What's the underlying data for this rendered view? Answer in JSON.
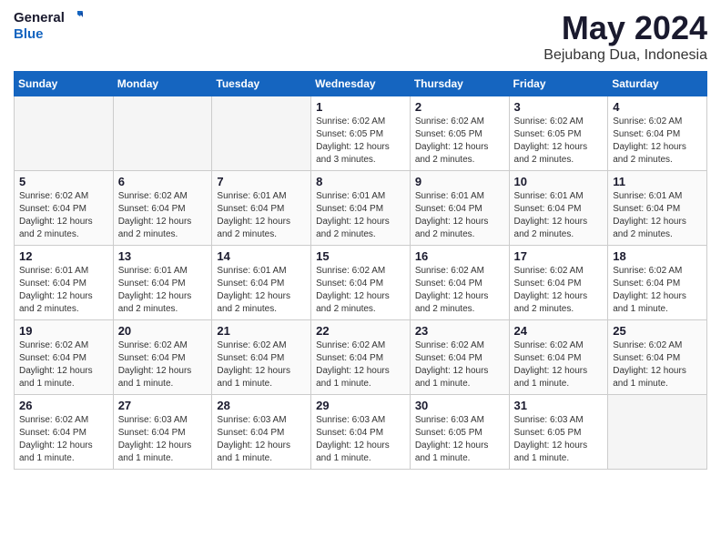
{
  "header": {
    "logo_line1": "General",
    "logo_line2": "Blue",
    "month_year": "May 2024",
    "location": "Bejubang Dua, Indonesia"
  },
  "days_of_week": [
    "Sunday",
    "Monday",
    "Tuesday",
    "Wednesday",
    "Thursday",
    "Friday",
    "Saturday"
  ],
  "weeks": [
    [
      {
        "day": "",
        "info": ""
      },
      {
        "day": "",
        "info": ""
      },
      {
        "day": "",
        "info": ""
      },
      {
        "day": "1",
        "info": "Sunrise: 6:02 AM\nSunset: 6:05 PM\nDaylight: 12 hours\nand 3 minutes."
      },
      {
        "day": "2",
        "info": "Sunrise: 6:02 AM\nSunset: 6:05 PM\nDaylight: 12 hours\nand 2 minutes."
      },
      {
        "day": "3",
        "info": "Sunrise: 6:02 AM\nSunset: 6:05 PM\nDaylight: 12 hours\nand 2 minutes."
      },
      {
        "day": "4",
        "info": "Sunrise: 6:02 AM\nSunset: 6:04 PM\nDaylight: 12 hours\nand 2 minutes."
      }
    ],
    [
      {
        "day": "5",
        "info": "Sunrise: 6:02 AM\nSunset: 6:04 PM\nDaylight: 12 hours\nand 2 minutes."
      },
      {
        "day": "6",
        "info": "Sunrise: 6:02 AM\nSunset: 6:04 PM\nDaylight: 12 hours\nand 2 minutes."
      },
      {
        "day": "7",
        "info": "Sunrise: 6:01 AM\nSunset: 6:04 PM\nDaylight: 12 hours\nand 2 minutes."
      },
      {
        "day": "8",
        "info": "Sunrise: 6:01 AM\nSunset: 6:04 PM\nDaylight: 12 hours\nand 2 minutes."
      },
      {
        "day": "9",
        "info": "Sunrise: 6:01 AM\nSunset: 6:04 PM\nDaylight: 12 hours\nand 2 minutes."
      },
      {
        "day": "10",
        "info": "Sunrise: 6:01 AM\nSunset: 6:04 PM\nDaylight: 12 hours\nand 2 minutes."
      },
      {
        "day": "11",
        "info": "Sunrise: 6:01 AM\nSunset: 6:04 PM\nDaylight: 12 hours\nand 2 minutes."
      }
    ],
    [
      {
        "day": "12",
        "info": "Sunrise: 6:01 AM\nSunset: 6:04 PM\nDaylight: 12 hours\nand 2 minutes."
      },
      {
        "day": "13",
        "info": "Sunrise: 6:01 AM\nSunset: 6:04 PM\nDaylight: 12 hours\nand 2 minutes."
      },
      {
        "day": "14",
        "info": "Sunrise: 6:01 AM\nSunset: 6:04 PM\nDaylight: 12 hours\nand 2 minutes."
      },
      {
        "day": "15",
        "info": "Sunrise: 6:02 AM\nSunset: 6:04 PM\nDaylight: 12 hours\nand 2 minutes."
      },
      {
        "day": "16",
        "info": "Sunrise: 6:02 AM\nSunset: 6:04 PM\nDaylight: 12 hours\nand 2 minutes."
      },
      {
        "day": "17",
        "info": "Sunrise: 6:02 AM\nSunset: 6:04 PM\nDaylight: 12 hours\nand 2 minutes."
      },
      {
        "day": "18",
        "info": "Sunrise: 6:02 AM\nSunset: 6:04 PM\nDaylight: 12 hours\nand 1 minute."
      }
    ],
    [
      {
        "day": "19",
        "info": "Sunrise: 6:02 AM\nSunset: 6:04 PM\nDaylight: 12 hours\nand 1 minute."
      },
      {
        "day": "20",
        "info": "Sunrise: 6:02 AM\nSunset: 6:04 PM\nDaylight: 12 hours\nand 1 minute."
      },
      {
        "day": "21",
        "info": "Sunrise: 6:02 AM\nSunset: 6:04 PM\nDaylight: 12 hours\nand 1 minute."
      },
      {
        "day": "22",
        "info": "Sunrise: 6:02 AM\nSunset: 6:04 PM\nDaylight: 12 hours\nand 1 minute."
      },
      {
        "day": "23",
        "info": "Sunrise: 6:02 AM\nSunset: 6:04 PM\nDaylight: 12 hours\nand 1 minute."
      },
      {
        "day": "24",
        "info": "Sunrise: 6:02 AM\nSunset: 6:04 PM\nDaylight: 12 hours\nand 1 minute."
      },
      {
        "day": "25",
        "info": "Sunrise: 6:02 AM\nSunset: 6:04 PM\nDaylight: 12 hours\nand 1 minute."
      }
    ],
    [
      {
        "day": "26",
        "info": "Sunrise: 6:02 AM\nSunset: 6:04 PM\nDaylight: 12 hours\nand 1 minute."
      },
      {
        "day": "27",
        "info": "Sunrise: 6:03 AM\nSunset: 6:04 PM\nDaylight: 12 hours\nand 1 minute."
      },
      {
        "day": "28",
        "info": "Sunrise: 6:03 AM\nSunset: 6:04 PM\nDaylight: 12 hours\nand 1 minute."
      },
      {
        "day": "29",
        "info": "Sunrise: 6:03 AM\nSunset: 6:04 PM\nDaylight: 12 hours\nand 1 minute."
      },
      {
        "day": "30",
        "info": "Sunrise: 6:03 AM\nSunset: 6:05 PM\nDaylight: 12 hours\nand 1 minute."
      },
      {
        "day": "31",
        "info": "Sunrise: 6:03 AM\nSunset: 6:05 PM\nDaylight: 12 hours\nand 1 minute."
      },
      {
        "day": "",
        "info": ""
      }
    ]
  ]
}
